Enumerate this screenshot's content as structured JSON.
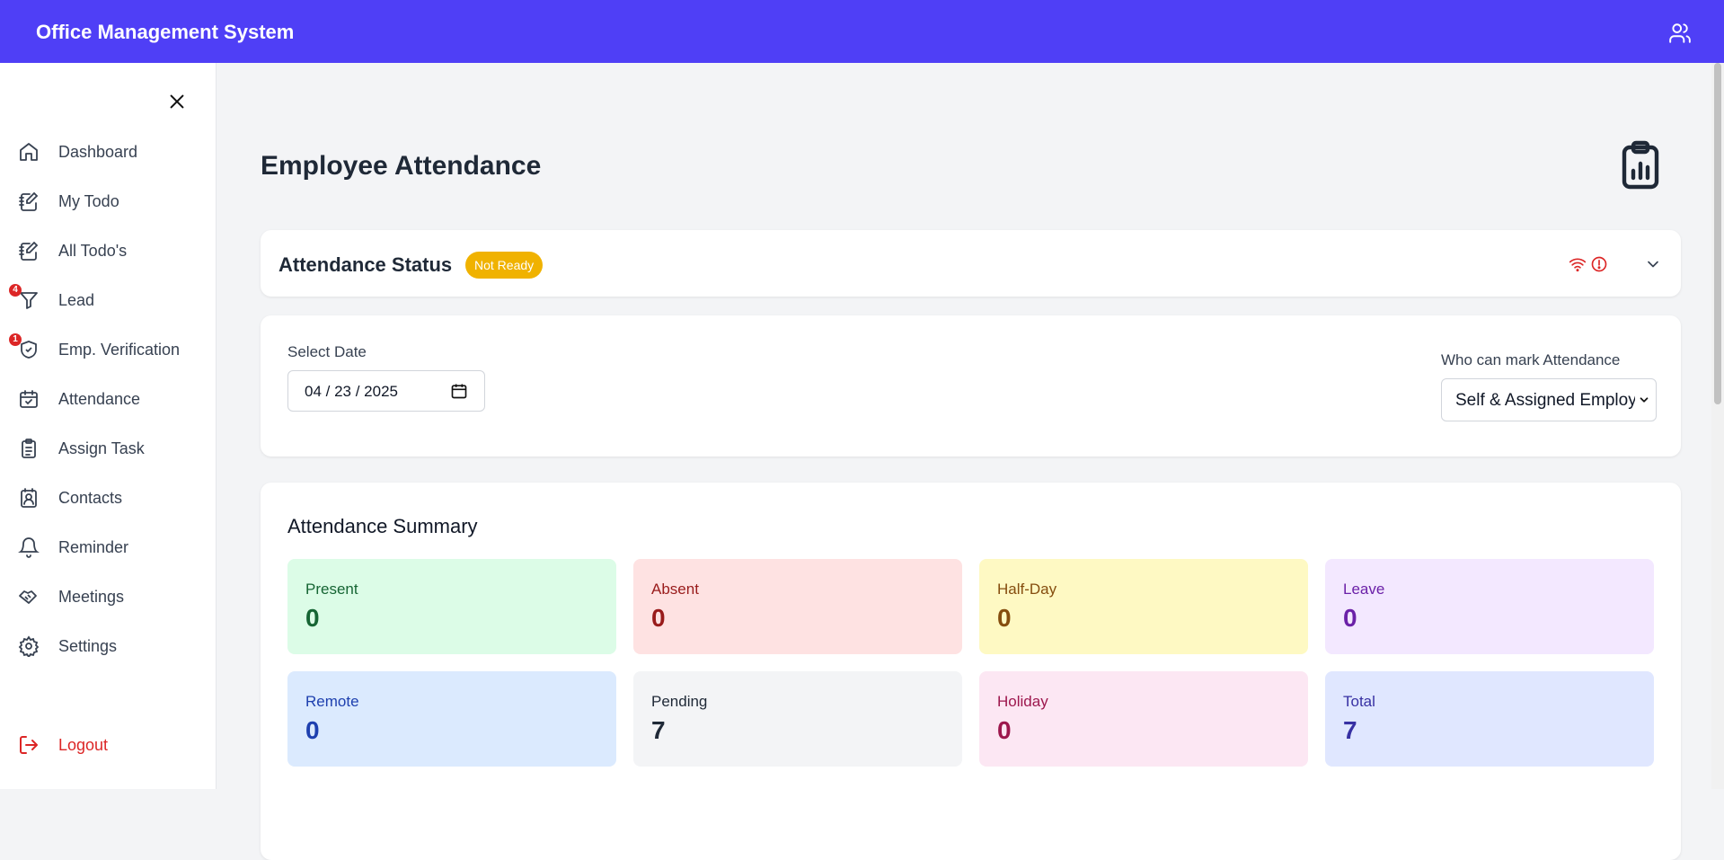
{
  "header": {
    "title": "Office Management System",
    "user_icon": "users-icon"
  },
  "sidebar": {
    "items": [
      {
        "label": "Dashboard",
        "icon": "home-icon"
      },
      {
        "label": "My Todo",
        "icon": "notebook-pen-icon"
      },
      {
        "label": "All Todo's",
        "icon": "notebook-pen-icon"
      },
      {
        "label": "Lead",
        "icon": "filter-icon",
        "badge": "4"
      },
      {
        "label": "Emp. Verification",
        "icon": "shield-check-icon",
        "badge": "1"
      },
      {
        "label": "Attendance",
        "icon": "calendar-check-icon"
      },
      {
        "label": "Assign Task",
        "icon": "clipboard-list-icon"
      },
      {
        "label": "Contacts",
        "icon": "contact-icon"
      },
      {
        "label": "Reminder",
        "icon": "bell-icon"
      },
      {
        "label": "Meetings",
        "icon": "handshake-icon"
      },
      {
        "label": "Settings",
        "icon": "gear-icon"
      }
    ],
    "logout": {
      "label": "Logout",
      "icon": "logout-icon"
    }
  },
  "main": {
    "page_title": "Employee Attendance",
    "status": {
      "title": "Attendance Status",
      "badge": "Not Ready"
    },
    "filters": {
      "date_label": "Select Date",
      "date_value": "04 / 23 / 2025",
      "who_label": "Who can mark Attendance",
      "who_value": "Self & Assigned Employees"
    },
    "summary": {
      "title": "Attendance Summary",
      "stats": [
        {
          "label": "Present",
          "value": "0"
        },
        {
          "label": "Absent",
          "value": "0"
        },
        {
          "label": "Half-Day",
          "value": "0"
        },
        {
          "label": "Leave",
          "value": "0"
        },
        {
          "label": "Remote",
          "value": "0"
        },
        {
          "label": "Pending",
          "value": "7"
        },
        {
          "label": "Holiday",
          "value": "0"
        },
        {
          "label": "Total",
          "value": "7"
        }
      ]
    }
  },
  "colors": {
    "header_bg": "#4f3ff6",
    "badge_warning": "#f0b200",
    "danger": "#dc2626"
  }
}
